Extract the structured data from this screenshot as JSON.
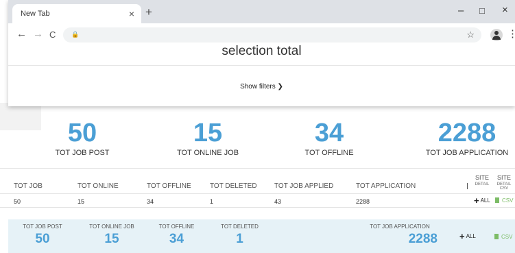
{
  "browser": {
    "tab_title": "New Tab",
    "tab_close": "×",
    "new_tab": "+",
    "minimize": "–",
    "maximize": "□",
    "close": "×",
    "back": "←",
    "forward": "→",
    "reload": "C",
    "lock": "🔒",
    "star": "☆",
    "menu": "⋮"
  },
  "page": {
    "title": "selection total",
    "show_filters": "Show filters ❯"
  },
  "stats": [
    {
      "value": "50",
      "label": "TOT JOB POST"
    },
    {
      "value": "15",
      "label": "TOT ONLINE JOB"
    },
    {
      "value": "34",
      "label": "TOT OFFLINE"
    },
    {
      "value": "2288",
      "label": "TOT JOB APPLICATION"
    }
  ],
  "table": {
    "headers": [
      "TOT JOB",
      "TOT ONLINE",
      "TOT OFFLINE",
      "TOT DELETED",
      "TOT JOB APPLIED",
      "TOT APPLICATION"
    ],
    "site_detail": {
      "top": "SITE",
      "bottom": "DETAIL"
    },
    "site_detail_csv": {
      "top": "SITE",
      "bottom": "DETAIL CSV"
    },
    "row": [
      "50",
      "15",
      "34",
      "1",
      "43",
      "2288"
    ],
    "all_label": "ALL",
    "csv_label": "CSV"
  },
  "footer": {
    "stats": [
      {
        "label": "TOT JOB POST",
        "value": "50"
      },
      {
        "label": "TOT ONLINE JOB",
        "value": "15"
      },
      {
        "label": "TOT OFFLINE",
        "value": "34"
      },
      {
        "label": "TOT DELETED",
        "value": "1"
      },
      {
        "label": "TOT JOB APPLICATION",
        "value": "2288"
      }
    ],
    "all_label": "ALL",
    "csv_label": "CSV"
  },
  "colors": {
    "accent": "#4b9fd5",
    "csv_green": "#7cbc66",
    "footer_bg": "#e6f2f7"
  }
}
